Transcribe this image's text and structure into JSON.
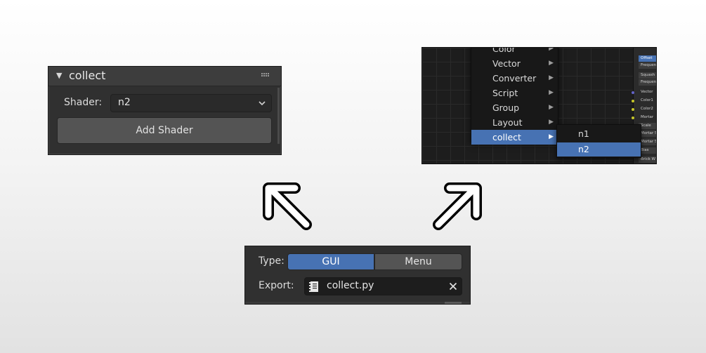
{
  "collect_panel": {
    "title": "collect",
    "shader_label": "Shader:",
    "shader_value": "n2",
    "add_button": "Add Shader"
  },
  "node_menu": {
    "items": [
      {
        "label": "Color"
      },
      {
        "label": "Vector"
      },
      {
        "label": "Converter"
      },
      {
        "label": "Script"
      },
      {
        "label": "Group"
      },
      {
        "label": "Layout"
      },
      {
        "label": "collect"
      }
    ],
    "submenu": [
      {
        "label": "n1"
      },
      {
        "label": "n2"
      }
    ],
    "node_fields": [
      "Offset",
      "Frequen",
      "Squash",
      "Frequen",
      "Vector",
      "Color1",
      "Color2",
      "Mortar",
      "Scale",
      "Mortar S",
      "Mortar S",
      "Bias",
      "Brick W"
    ]
  },
  "type_panel": {
    "type_label": "Type:",
    "type_options": [
      "GUI",
      "Menu"
    ],
    "type_selected": "GUI",
    "export_label": "Export:",
    "export_file": "collect.py"
  },
  "colors": {
    "accent": "#4772b3",
    "panel_bg": "#303030",
    "button_bg": "#545454"
  },
  "icons": [
    "disclosure-triangle-icon",
    "drag-grip-icon",
    "chevron-down-icon",
    "submenu-arrow-icon",
    "text-file-icon",
    "close-icon",
    "arrow-up-left-icon",
    "arrow-up-right-icon"
  ]
}
